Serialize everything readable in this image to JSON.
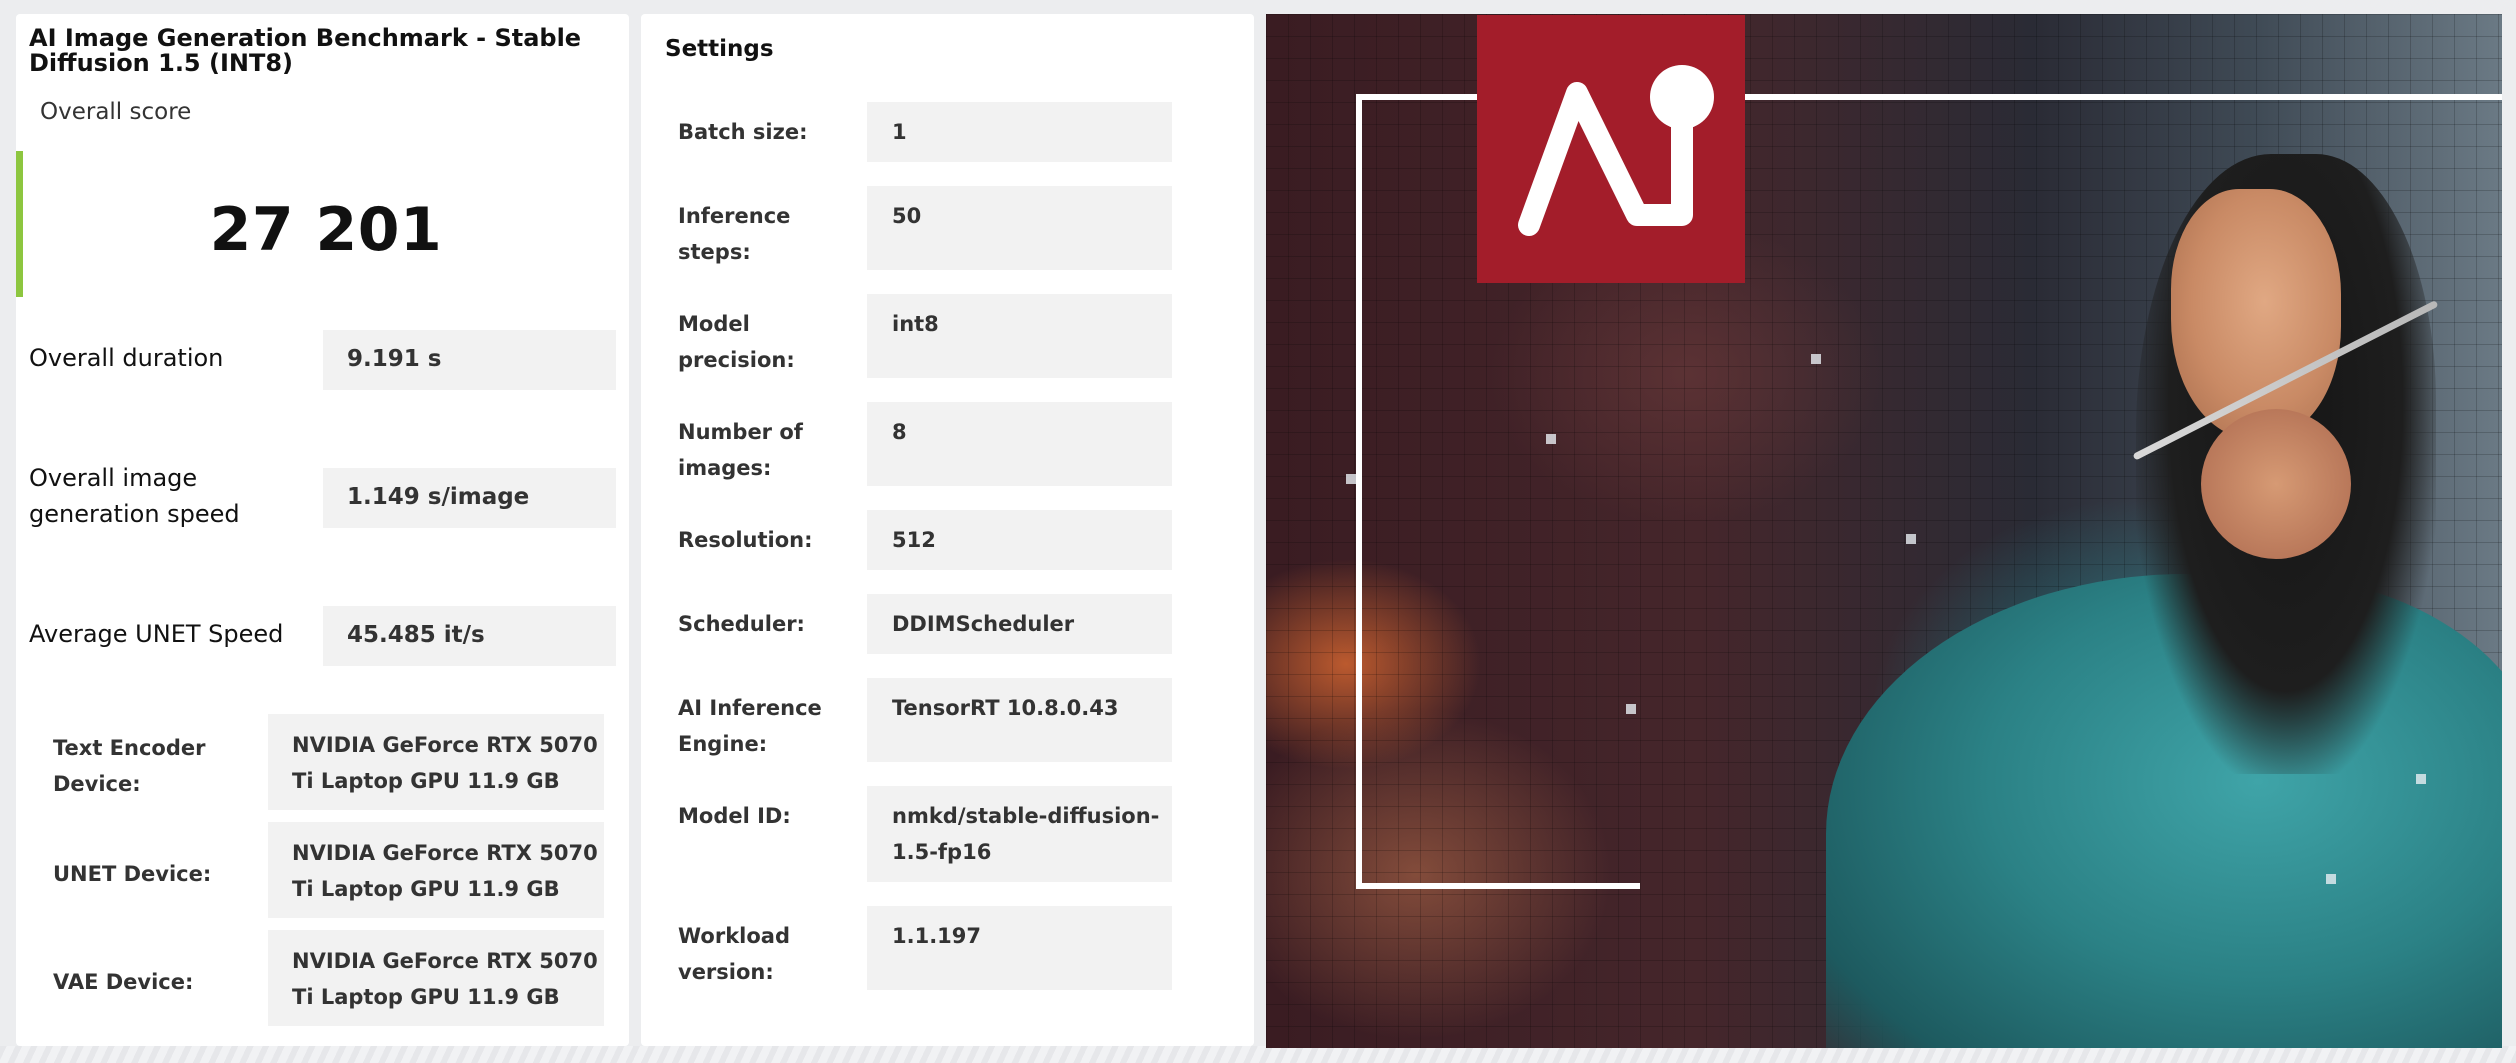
{
  "benchmark": {
    "title": "AI Image Generation Benchmark - Stable Diffusion 1.5 (INT8)",
    "score_caption": "Overall score",
    "score_value": "27 201",
    "accent_color": "#8dc63f"
  },
  "metrics": [
    {
      "label": "Overall duration",
      "value": "9.191 s"
    },
    {
      "label": "Overall image generation speed",
      "value": "1.149 s/image"
    },
    {
      "label": "Average UNET Speed",
      "value": "45.485 it/s"
    }
  ],
  "devices": [
    {
      "label": "Text Encoder Device:",
      "value": "NVIDIA GeForce RTX 5070 Ti Laptop GPU 11.9 GB"
    },
    {
      "label": "UNET Device:",
      "value": "NVIDIA GeForce RTX 5070 Ti Laptop GPU 11.9 GB"
    },
    {
      "label": "VAE Device:",
      "value": "NVIDIA GeForce RTX 5070 Ti Laptop GPU 11.9 GB"
    }
  ],
  "settings": {
    "title": "Settings",
    "items": [
      {
        "label": "Batch size:",
        "value": "1"
      },
      {
        "label": "Inference steps:",
        "value": "50"
      },
      {
        "label": "Model precision:",
        "value": "int8"
      },
      {
        "label": "Number of images:",
        "value": "8"
      },
      {
        "label": "Resolution:",
        "value": "512"
      },
      {
        "label": "Scheduler:",
        "value": "DDIMScheduler"
      },
      {
        "label": "AI Inference Engine:",
        "value": "TensorRT 10.8.0.43"
      },
      {
        "label": "Model ID:",
        "value": "nmkd/stable-diffusion-1.5-fp16"
      },
      {
        "label": "Workload version:",
        "value": "1.1.197"
      }
    ]
  },
  "hero": {
    "logo_color": "#a31d2a",
    "icons": [
      "ai-logo-icon"
    ]
  }
}
